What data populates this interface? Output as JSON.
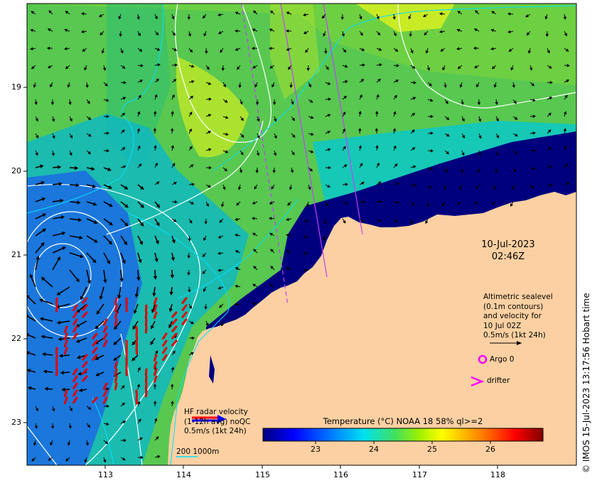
{
  "map": {
    "lon_range": [
      112.0,
      119.0
    ],
    "lat_range": [
      -23.55,
      -18.0
    ],
    "x_ticks": [
      "113",
      "114",
      "115",
      "116",
      "117",
      "118"
    ],
    "y_ticks": [
      "19",
      "20",
      "21",
      "22",
      "23"
    ],
    "land_color": "#fcd0a2",
    "deep_sea_color": "#00007f"
  },
  "datetime": {
    "date": "10-Jul-2023",
    "time": "02:46Z"
  },
  "altimetry_legend": {
    "line1": "Altimetric sealevel",
    "line2": "(0.1m contours)",
    "line3": "and velocity for",
    "line4": "10 Jul 02Z",
    "line5": "0.5m/s (1kt 24h)"
  },
  "argo": {
    "label": "Argo 0",
    "color": "#ff00ff"
  },
  "drifter": {
    "label": "drifter",
    "color": "#ff00ff"
  },
  "hf_radar_legend": {
    "line1": "HF radar velocity",
    "line2": "(1-12h avg) noQC",
    "line3": "0.5m/s (1kt 24h)",
    "arrow_color": "#ff0000"
  },
  "colorbar": {
    "title": "Temperature (°C) NOAA 18 58% ql>=2",
    "vmin": 22.0,
    "vmax": 26.8,
    "ticks": [
      "23",
      "24",
      "25",
      "26"
    ]
  },
  "scale": {
    "label": "200  1000m"
  },
  "copyright": "© IMOS 15-Jul-2023 13:17:56 Hobart time"
}
